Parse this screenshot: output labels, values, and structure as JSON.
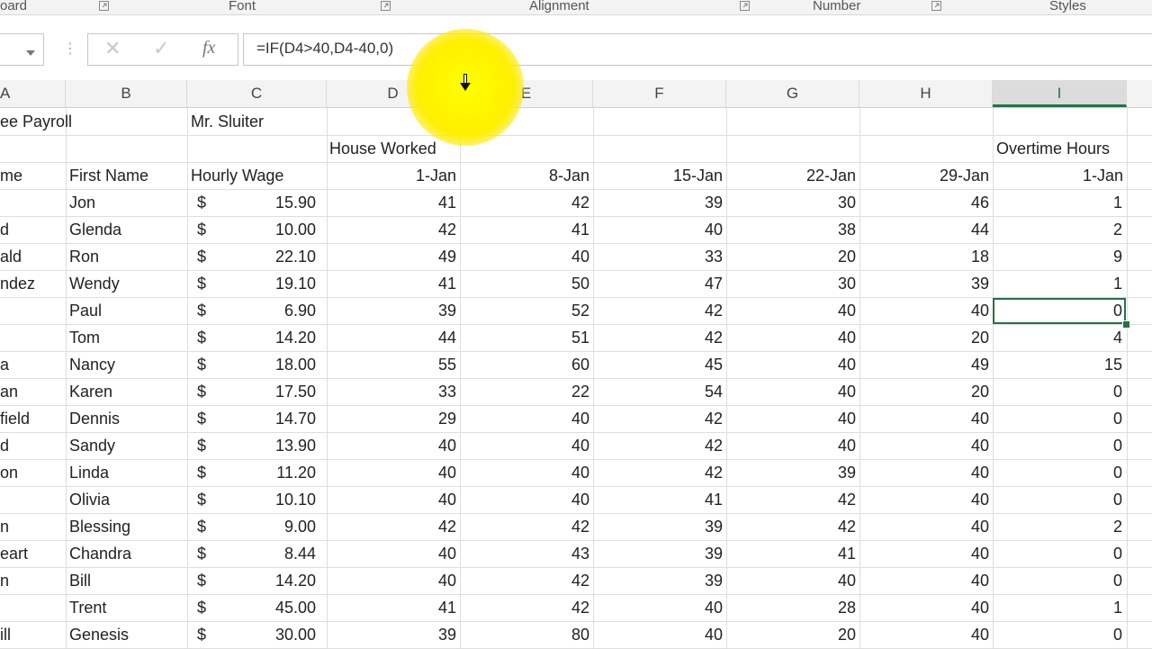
{
  "ribbon": {
    "groups": [
      {
        "label": "oard"
      },
      {
        "label": "Font"
      },
      {
        "label": "Alignment"
      },
      {
        "label": "Number"
      },
      {
        "label": "Styles"
      }
    ]
  },
  "formula_bar": {
    "formula": "=IF(D4>40,D4-40,0)",
    "cancel_icon": "close-icon",
    "enter_icon": "check-icon",
    "fx_label": "fx"
  },
  "columns": [
    "A",
    "B",
    "C",
    "D",
    "E",
    "F",
    "G",
    "H",
    "I"
  ],
  "selected_column": "I",
  "sheet": {
    "title": "ee Payroll",
    "author": "Mr. Sluiter",
    "hours_label": "House Worked",
    "overtime_label": "Overtime Hours",
    "headers": {
      "last_name": "me",
      "first_name": "First Name",
      "wage": "Hourly Wage",
      "d": "1-Jan",
      "e": "8-Jan",
      "f": "15-Jan",
      "g": "22-Jan",
      "h": "29-Jan",
      "i": "1-Jan"
    },
    "rows": [
      {
        "last": "",
        "first": "Jon",
        "cur": "$",
        "wage": "15.90",
        "d": "41",
        "e": "42",
        "f": "39",
        "g": "30",
        "h": "46",
        "i": "1"
      },
      {
        "last": "d",
        "first": "Glenda",
        "cur": "$",
        "wage": "10.00",
        "d": "42",
        "e": "41",
        "f": "40",
        "g": "38",
        "h": "44",
        "i": "2"
      },
      {
        "last": "ald",
        "first": "Ron",
        "cur": "$",
        "wage": "22.10",
        "d": "49",
        "e": "40",
        "f": "33",
        "g": "20",
        "h": "18",
        "i": "9"
      },
      {
        "last": "ndez",
        "first": "Wendy",
        "cur": "$",
        "wage": "19.10",
        "d": "41",
        "e": "50",
        "f": "47",
        "g": "30",
        "h": "39",
        "i": "1"
      },
      {
        "last": "",
        "first": "Paul",
        "cur": "$",
        "wage": "6.90",
        "d": "39",
        "e": "52",
        "f": "42",
        "g": "40",
        "h": "40",
        "i": "0"
      },
      {
        "last": "",
        "first": "Tom",
        "cur": "$",
        "wage": "14.20",
        "d": "44",
        "e": "51",
        "f": "42",
        "g": "40",
        "h": "20",
        "i": "4"
      },
      {
        "last": "a",
        "first": "Nancy",
        "cur": "$",
        "wage": "18.00",
        "d": "55",
        "e": "60",
        "f": "45",
        "g": "40",
        "h": "49",
        "i": "15"
      },
      {
        "last": "an",
        "first": "Karen",
        "cur": "$",
        "wage": "17.50",
        "d": "33",
        "e": "22",
        "f": "54",
        "g": "40",
        "h": "20",
        "i": "0"
      },
      {
        "last": "field",
        "first": "Dennis",
        "cur": "$",
        "wage": "14.70",
        "d": "29",
        "e": "40",
        "f": "42",
        "g": "40",
        "h": "40",
        "i": "0"
      },
      {
        "last": "d",
        "first": "Sandy",
        "cur": "$",
        "wage": "13.90",
        "d": "40",
        "e": "40",
        "f": "42",
        "g": "40",
        "h": "40",
        "i": "0"
      },
      {
        "last": "on",
        "first": "Linda",
        "cur": "$",
        "wage": "11.20",
        "d": "40",
        "e": "40",
        "f": "42",
        "g": "39",
        "h": "40",
        "i": "0"
      },
      {
        "last": "",
        "first": "Olivia",
        "cur": "$",
        "wage": "10.10",
        "d": "40",
        "e": "40",
        "f": "41",
        "g": "42",
        "h": "40",
        "i": "0"
      },
      {
        "last": "n",
        "first": "Blessing",
        "cur": "$",
        "wage": "9.00",
        "d": "42",
        "e": "42",
        "f": "39",
        "g": "42",
        "h": "40",
        "i": "2"
      },
      {
        "last": "eart",
        "first": "Chandra",
        "cur": "$",
        "wage": "8.44",
        "d": "40",
        "e": "43",
        "f": "39",
        "g": "41",
        "h": "40",
        "i": "0"
      },
      {
        "last": "n",
        "first": "Bill",
        "cur": "$",
        "wage": "14.20",
        "d": "40",
        "e": "42",
        "f": "39",
        "g": "40",
        "h": "40",
        "i": "0"
      },
      {
        "last": "",
        "first": "Trent",
        "cur": "$",
        "wage": "45.00",
        "d": "41",
        "e": "42",
        "f": "40",
        "g": "28",
        "h": "40",
        "i": "1"
      },
      {
        "last": "ill",
        "first": "Genesis",
        "cur": "$",
        "wage": "30.00",
        "d": "39",
        "e": "80",
        "f": "40",
        "g": "20",
        "h": "40",
        "i": "0"
      }
    ]
  },
  "colors": {
    "accent": "#217346",
    "highlight": "#ffff00"
  }
}
